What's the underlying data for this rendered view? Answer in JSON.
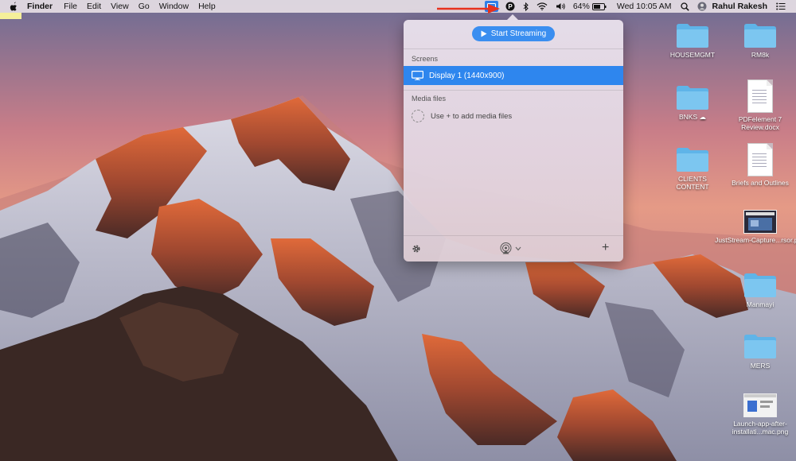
{
  "menubar": {
    "app_name": "Finder",
    "menus": [
      "File",
      "Edit",
      "View",
      "Go",
      "Window",
      "Help"
    ],
    "status": {
      "battery": "64%",
      "clock": "Wed 10:05 AM",
      "user": "Rahul Rakesh"
    },
    "icons": [
      "juststream-icon",
      "p-icon",
      "bluetooth-icon",
      "wifi-icon",
      "volume-icon",
      "battery-icon",
      "search-icon",
      "user-avatar-icon",
      "list-icon"
    ]
  },
  "popover": {
    "start_label": "Start Streaming",
    "screens_header": "Screens",
    "display_label": "Display 1 (1440x900)",
    "media_header": "Media files",
    "add_media_label": "Use + to add media files",
    "add_icon_glyph": "+",
    "accent": "#2e86ee"
  },
  "desktop": {
    "items": [
      {
        "label": "HOUSEMGMT",
        "kind": "folder"
      },
      {
        "label": "RM8k",
        "kind": "folder"
      },
      {
        "label": "BNKS ☁",
        "kind": "folder"
      },
      {
        "label": "PDFelement 7 Review.docx",
        "kind": "doc"
      },
      {
        "label": "CLIENTS CONTENT",
        "kind": "folder"
      },
      {
        "label": "Briefs and Outlines",
        "kind": "doc"
      },
      {
        "label": "JustStream-Capture...rsor.png",
        "kind": "image"
      },
      {
        "label": "Manmayi",
        "kind": "folder"
      },
      {
        "label": "MERS",
        "kind": "folder"
      },
      {
        "label": "Launch-app-after-installati...mac.png",
        "kind": "image"
      }
    ]
  }
}
